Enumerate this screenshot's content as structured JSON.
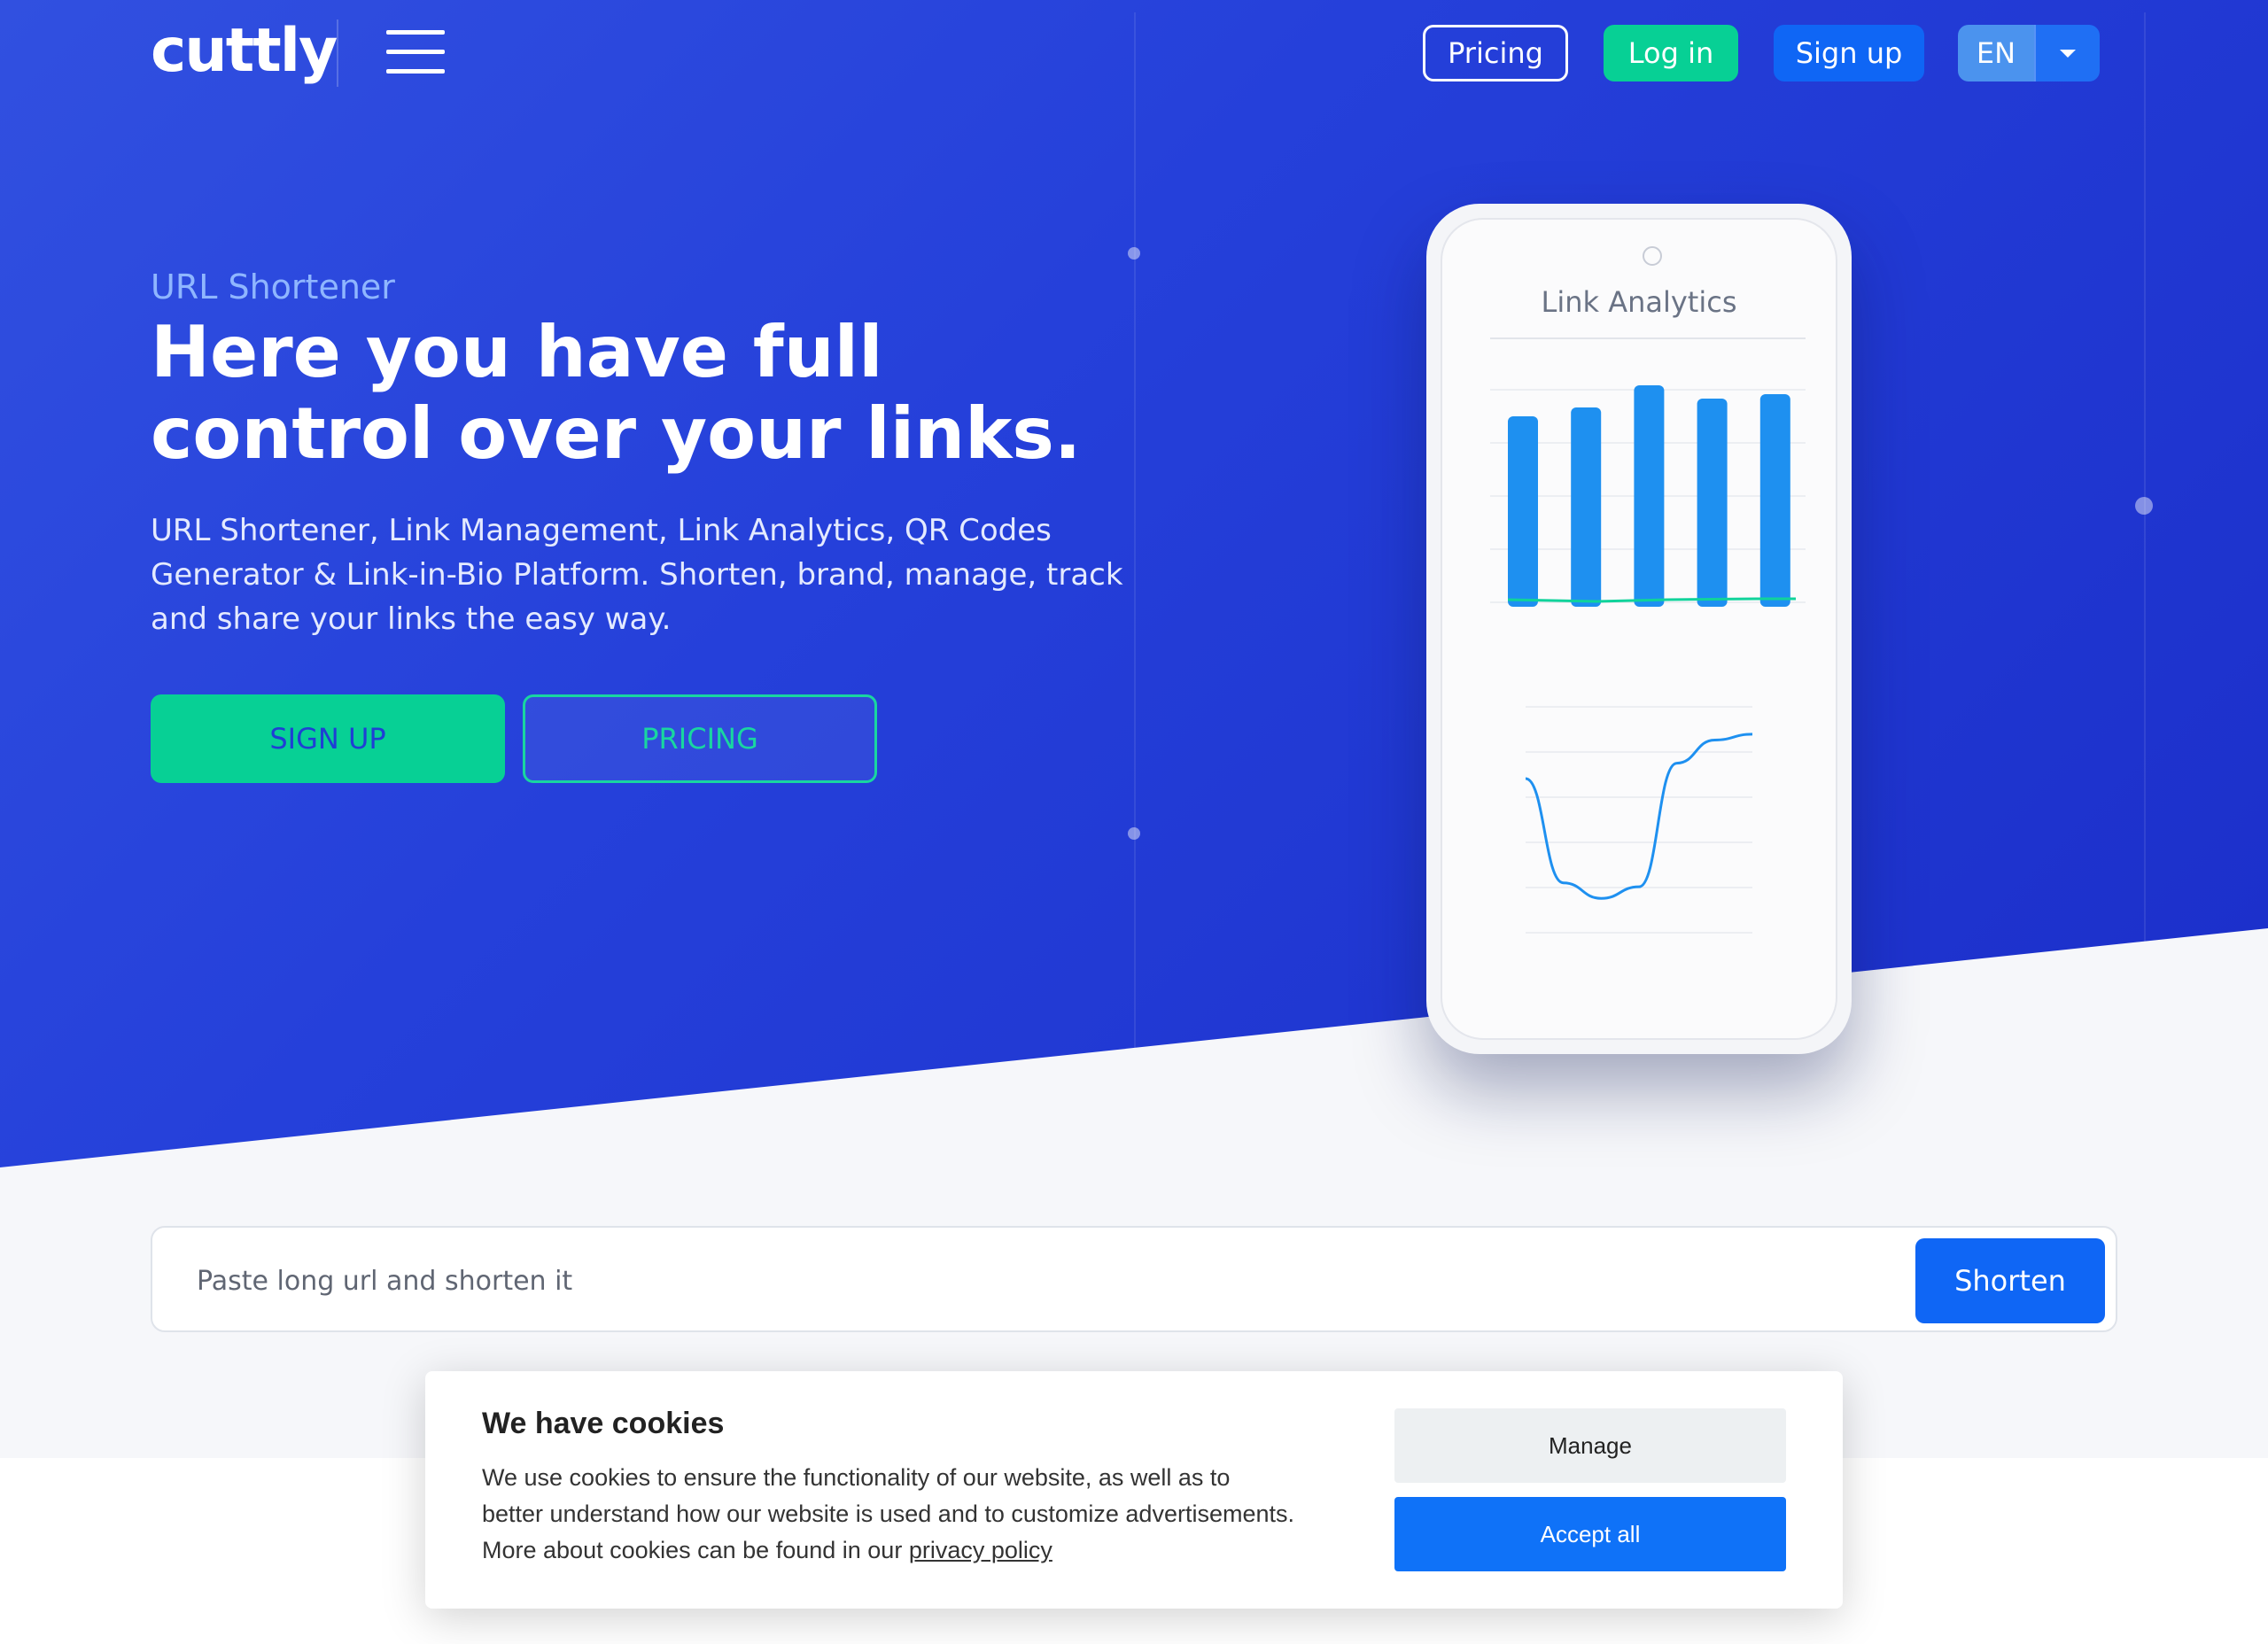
{
  "nav": {
    "logo": "cuttly",
    "pricing": "Pricing",
    "login": "Log in",
    "signup": "Sign up",
    "language": "EN"
  },
  "hero": {
    "eyebrow": "URL Shortener",
    "title": "Here you have full control over your links.",
    "lead": "URL Shortener, Link Management, Link Analytics, QR Codes Generator & Link-in-Bio Platform. Shorten, brand, manage, track and share your links the easy way.",
    "cta_signup": "SIGN UP",
    "cta_pricing": "PRICING"
  },
  "phone": {
    "title": "Link Analytics",
    "bar_chart": {
      "values": [
        0.86,
        0.9,
        1.0,
        0.94,
        0.96
      ],
      "color": "#1e90f0"
    },
    "line_chart": {
      "values": [
        0.72,
        0.18,
        0.1,
        0.16,
        0.8,
        0.92,
        0.95
      ],
      "color": "#1e90f0"
    }
  },
  "shorten": {
    "placeholder": "Paste long url and shorten it",
    "button": "Shorten"
  },
  "cookie": {
    "title": "We have cookies",
    "text": "We use cookies to ensure the functionality of our website, as well as to better understand how our website is used and to customize advertisements. More about cookies can be found in our ",
    "link": "privacy policy",
    "manage": "Manage",
    "accept": "Accept all"
  },
  "colors": {
    "hero": "#2540da",
    "green": "#07d095",
    "blue": "#0f66f5"
  }
}
